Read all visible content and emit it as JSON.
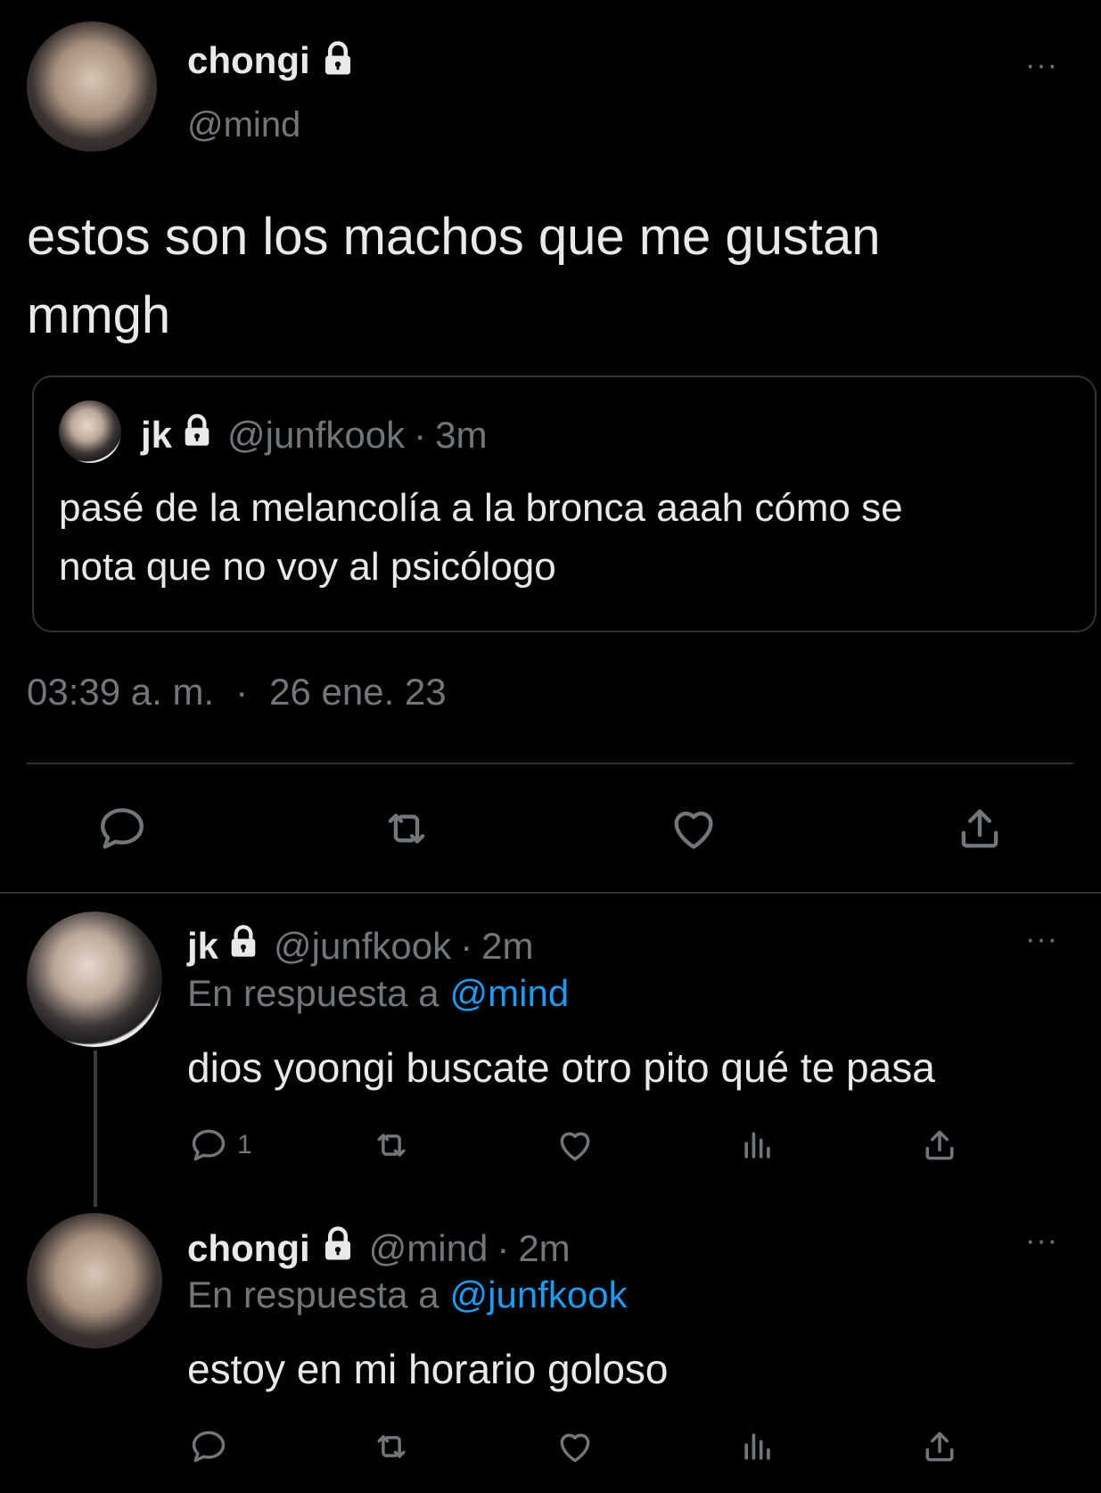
{
  "main_tweet": {
    "display_name": "chongi",
    "handle": "@mind",
    "text_line1": "estos son los machos que me gustan",
    "text_line2": "mmgh",
    "more": "···",
    "quoted": {
      "display_name": "jk",
      "handle": "@junfkook",
      "sep": "·",
      "time": "3m",
      "text_line1": "pasé de la melancolía a la bronca aaah cómo se",
      "text_line2": "nota que no voy al psicólogo"
    },
    "time": "03:39 a. m.",
    "dot": "·",
    "date": "26 ene. 23",
    "actions": [
      "reply-icon",
      "retweet-icon",
      "like-icon",
      "share-icon"
    ]
  },
  "replies": [
    {
      "display_name": "jk",
      "handle": "@junfkook",
      "sep": "·",
      "time": "2m",
      "reply_prefix": "En respuesta a",
      "reply_to": "@mind",
      "text": "dios yoongi buscate otro pito qué te pasa",
      "reply_count": "1",
      "more": "···"
    },
    {
      "display_name": "chongi",
      "handle": "@mind",
      "sep": "·",
      "time": "2m",
      "reply_prefix": "En respuesta a",
      "reply_to": "@junfkook",
      "text": "estoy en mi horario goloso",
      "reply_count": "",
      "more": "···"
    }
  ],
  "colors": {
    "background": "#000000",
    "text": "#e7e9ea",
    "muted": "#71767b",
    "link": "#1d9bf0",
    "border": "#2f3336"
  }
}
